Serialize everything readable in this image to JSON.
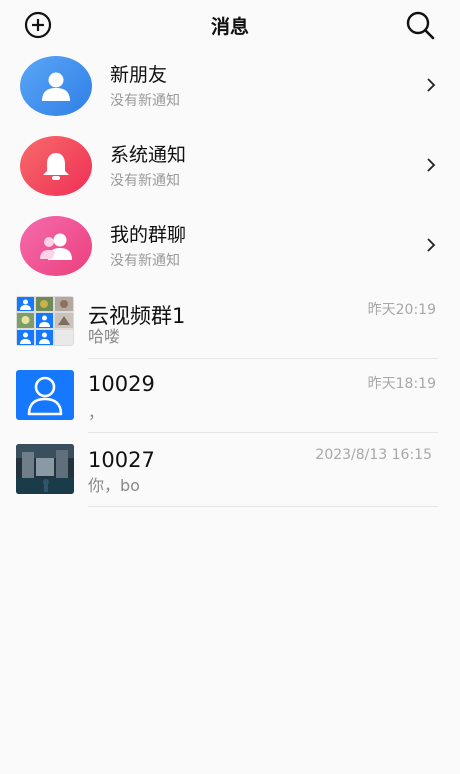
{
  "header": {
    "title": "消息"
  },
  "system_items": [
    {
      "name": "新朋友",
      "subtitle": "没有新通知",
      "color": "#3d8ef2"
    },
    {
      "name": "系统通知",
      "subtitle": "没有新通知",
      "color": "#f2465a"
    },
    {
      "name": "我的群聊",
      "subtitle": "没有新通知",
      "color": "#f2468a"
    }
  ],
  "chats": [
    {
      "name": "云视频群1",
      "message": "哈喽",
      "time": "昨天20:19"
    },
    {
      "name": "10029",
      "message": "，",
      "time": "昨天18:19"
    },
    {
      "name": "10027",
      "message": "你，bo",
      "time": "2023/8/13 16:15"
    }
  ],
  "colors": {
    "blue_avatar": "#1677ff",
    "separator": "#e6e6e6"
  }
}
